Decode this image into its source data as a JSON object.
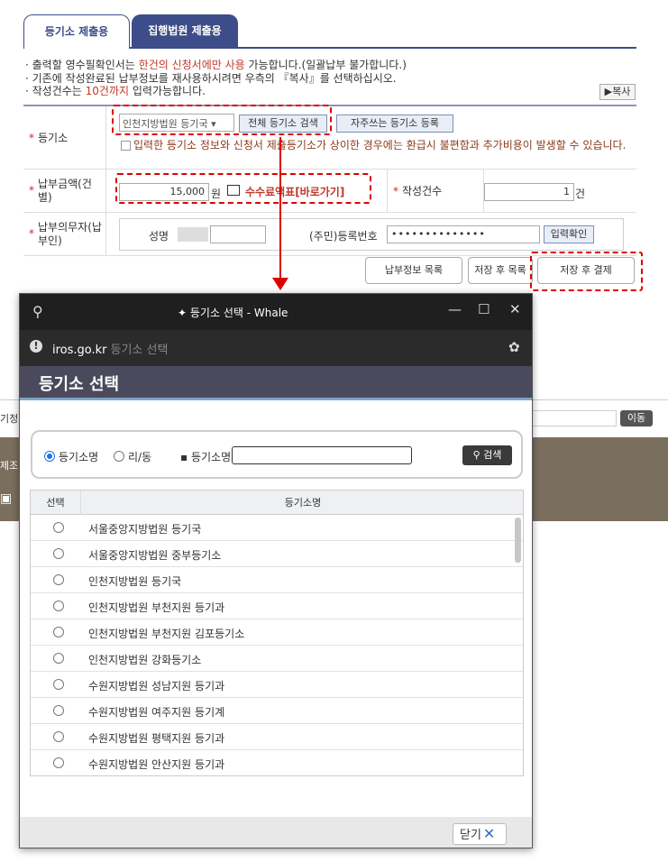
{
  "tabs": {
    "registry": "등기소 제출용",
    "court": "집행법원 제출용"
  },
  "notices": {
    "line1_pre": "· 출력할 영수필확인서는 ",
    "line1_hl": "한건의 신청서에만 사용",
    "line1_post": " 가능합니다.(일괄납부 불가합니다.)",
    "line2": "· 기존에 작성완료된 납부정보를 재사용하시려면 우측의 『복사』를 선택하십시오.",
    "line3_pre": "· 작성건수는 ",
    "line3_hl": "10건까지",
    "line3_post": " 입력가능합니다."
  },
  "copy_button": "▶복사",
  "form": {
    "registry_label": "등기소",
    "registry_select": "인천지방법원 등기국",
    "search_all_button": "전체 등기소 검색",
    "frequent_button": "자주쓰는 등기소 등록",
    "warning": "입력한 등기소 정보와 신청서 제출등기소가 상이한 경우에는 환급시 불편함과 추가비용이 발생할 수 있습니다.",
    "amount_label": "납부금액(건별)",
    "amount_value": "15,000",
    "amount_unit": "원",
    "fee_link": "수수료액표[바로가기]",
    "count_label": "작성건수",
    "count_value": "1",
    "count_unit": "건",
    "payer_label": "납부의무자(납부인)",
    "name_label": "성명",
    "id_label": "(주민)등록번호",
    "id_value": "••••••••••••••",
    "confirm_button": "입력확인"
  },
  "bottom_buttons": {
    "list": "납부정보 목록",
    "save_list": "저장 후 목록",
    "save_pay": "저장 후 결제"
  },
  "background": {
    "left1": "기정",
    "left2": "제조",
    "move_button": "이동"
  },
  "popup": {
    "window_title": "등기소 선택 - Whale",
    "url": "iros.go.kr",
    "url_page": "등기소 선택",
    "heading": "등기소 선택",
    "radio_name": "등기소명",
    "radio_area": "리/동",
    "search_label": "▪ 등기소명",
    "search_button": "검색",
    "col_select": "선택",
    "col_name": "등기소명",
    "offices": [
      "서울중앙지방법원 등기국",
      "서울중앙지방법원 중부등기소",
      "인천지방법원 등기국",
      "인천지방법원 부천지원 등기과",
      "인천지방법원 부천지원 김포등기소",
      "인천지방법원 강화등기소",
      "수원지방법원 성남지원 등기과",
      "수원지방법원 여주지원 등기계",
      "수원지방법원 평택지원 등기과",
      "수원지방법원 안산지원 등기과"
    ],
    "close_button": "닫기"
  }
}
